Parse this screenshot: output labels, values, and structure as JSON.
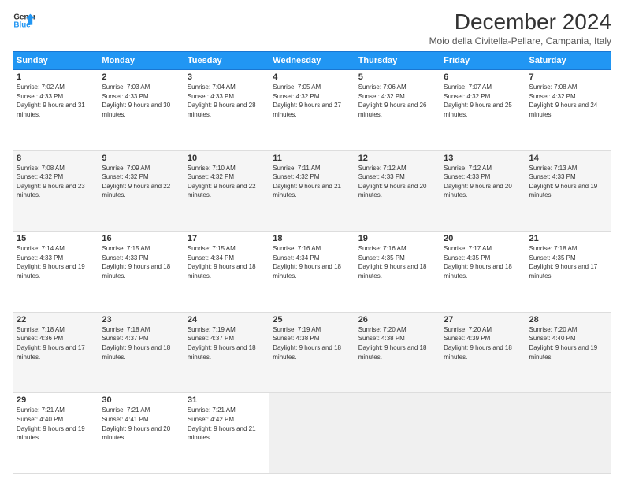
{
  "header": {
    "logo_line1": "General",
    "logo_line2": "Blue",
    "month_title": "December 2024",
    "location": "Moio della Civitella-Pellare, Campania, Italy"
  },
  "days_of_week": [
    "Sunday",
    "Monday",
    "Tuesday",
    "Wednesday",
    "Thursday",
    "Friday",
    "Saturday"
  ],
  "weeks": [
    [
      {
        "num": "1",
        "sunrise": "7:02 AM",
        "sunset": "4:33 PM",
        "daylight": "9 hours and 31 minutes."
      },
      {
        "num": "2",
        "sunrise": "7:03 AM",
        "sunset": "4:33 PM",
        "daylight": "9 hours and 30 minutes."
      },
      {
        "num": "3",
        "sunrise": "7:04 AM",
        "sunset": "4:33 PM",
        "daylight": "9 hours and 28 minutes."
      },
      {
        "num": "4",
        "sunrise": "7:05 AM",
        "sunset": "4:32 PM",
        "daylight": "9 hours and 27 minutes."
      },
      {
        "num": "5",
        "sunrise": "7:06 AM",
        "sunset": "4:32 PM",
        "daylight": "9 hours and 26 minutes."
      },
      {
        "num": "6",
        "sunrise": "7:07 AM",
        "sunset": "4:32 PM",
        "daylight": "9 hours and 25 minutes."
      },
      {
        "num": "7",
        "sunrise": "7:08 AM",
        "sunset": "4:32 PM",
        "daylight": "9 hours and 24 minutes."
      }
    ],
    [
      {
        "num": "8",
        "sunrise": "7:08 AM",
        "sunset": "4:32 PM",
        "daylight": "9 hours and 23 minutes."
      },
      {
        "num": "9",
        "sunrise": "7:09 AM",
        "sunset": "4:32 PM",
        "daylight": "9 hours and 22 minutes."
      },
      {
        "num": "10",
        "sunrise": "7:10 AM",
        "sunset": "4:32 PM",
        "daylight": "9 hours and 22 minutes."
      },
      {
        "num": "11",
        "sunrise": "7:11 AM",
        "sunset": "4:32 PM",
        "daylight": "9 hours and 21 minutes."
      },
      {
        "num": "12",
        "sunrise": "7:12 AM",
        "sunset": "4:33 PM",
        "daylight": "9 hours and 20 minutes."
      },
      {
        "num": "13",
        "sunrise": "7:12 AM",
        "sunset": "4:33 PM",
        "daylight": "9 hours and 20 minutes."
      },
      {
        "num": "14",
        "sunrise": "7:13 AM",
        "sunset": "4:33 PM",
        "daylight": "9 hours and 19 minutes."
      }
    ],
    [
      {
        "num": "15",
        "sunrise": "7:14 AM",
        "sunset": "4:33 PM",
        "daylight": "9 hours and 19 minutes."
      },
      {
        "num": "16",
        "sunrise": "7:15 AM",
        "sunset": "4:33 PM",
        "daylight": "9 hours and 18 minutes."
      },
      {
        "num": "17",
        "sunrise": "7:15 AM",
        "sunset": "4:34 PM",
        "daylight": "9 hours and 18 minutes."
      },
      {
        "num": "18",
        "sunrise": "7:16 AM",
        "sunset": "4:34 PM",
        "daylight": "9 hours and 18 minutes."
      },
      {
        "num": "19",
        "sunrise": "7:16 AM",
        "sunset": "4:35 PM",
        "daylight": "9 hours and 18 minutes."
      },
      {
        "num": "20",
        "sunrise": "7:17 AM",
        "sunset": "4:35 PM",
        "daylight": "9 hours and 18 minutes."
      },
      {
        "num": "21",
        "sunrise": "7:18 AM",
        "sunset": "4:35 PM",
        "daylight": "9 hours and 17 minutes."
      }
    ],
    [
      {
        "num": "22",
        "sunrise": "7:18 AM",
        "sunset": "4:36 PM",
        "daylight": "9 hours and 17 minutes."
      },
      {
        "num": "23",
        "sunrise": "7:18 AM",
        "sunset": "4:37 PM",
        "daylight": "9 hours and 18 minutes."
      },
      {
        "num": "24",
        "sunrise": "7:19 AM",
        "sunset": "4:37 PM",
        "daylight": "9 hours and 18 minutes."
      },
      {
        "num": "25",
        "sunrise": "7:19 AM",
        "sunset": "4:38 PM",
        "daylight": "9 hours and 18 minutes."
      },
      {
        "num": "26",
        "sunrise": "7:20 AM",
        "sunset": "4:38 PM",
        "daylight": "9 hours and 18 minutes."
      },
      {
        "num": "27",
        "sunrise": "7:20 AM",
        "sunset": "4:39 PM",
        "daylight": "9 hours and 18 minutes."
      },
      {
        "num": "28",
        "sunrise": "7:20 AM",
        "sunset": "4:40 PM",
        "daylight": "9 hours and 19 minutes."
      }
    ],
    [
      {
        "num": "29",
        "sunrise": "7:21 AM",
        "sunset": "4:40 PM",
        "daylight": "9 hours and 19 minutes."
      },
      {
        "num": "30",
        "sunrise": "7:21 AM",
        "sunset": "4:41 PM",
        "daylight": "9 hours and 20 minutes."
      },
      {
        "num": "31",
        "sunrise": "7:21 AM",
        "sunset": "4:42 PM",
        "daylight": "9 hours and 21 minutes."
      },
      null,
      null,
      null,
      null
    ]
  ]
}
